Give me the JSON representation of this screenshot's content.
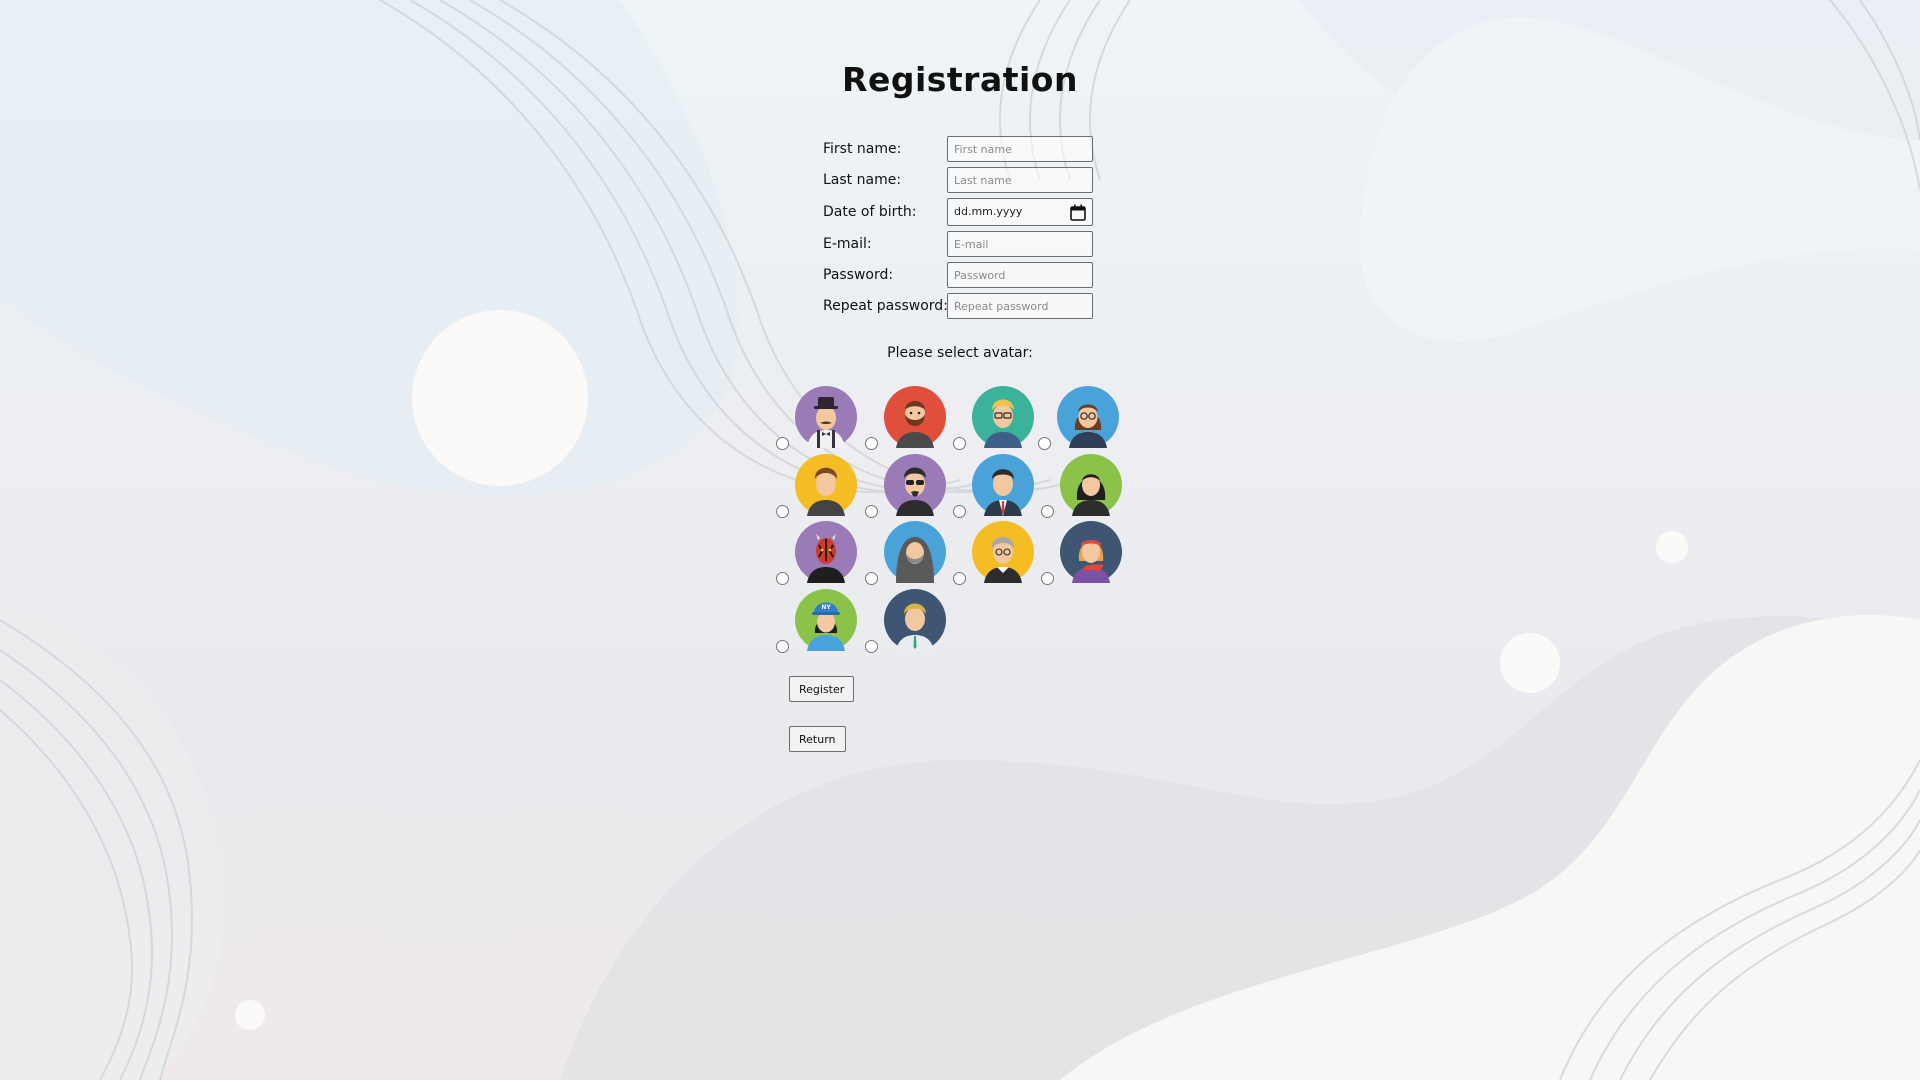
{
  "page": {
    "title": "Registration"
  },
  "form": {
    "fields": [
      {
        "label": "First name:",
        "placeholder": "First name"
      },
      {
        "label": "Last name:",
        "placeholder": "Last name"
      },
      {
        "label": "Date of birth:",
        "value": "dd.mm.yyyy"
      },
      {
        "label": "E-mail:",
        "placeholder": "E-mail"
      },
      {
        "label": "Password:",
        "placeholder": "Password"
      },
      {
        "label": "Repeat password:",
        "placeholder": "Repeat password"
      }
    ]
  },
  "avatars": {
    "heading": "Please select avatar:",
    "count": 14
  },
  "buttons": {
    "register": "Register",
    "return": "Return"
  },
  "icons": {
    "calendar": "calendar-icon"
  },
  "colors": {
    "input_border": "#6d6d6d",
    "avatar_purple": "#9b7ab8",
    "avatar_red": "#e04e3c",
    "avatar_teal": "#3bb39b",
    "avatar_blue": "#4aa3d8",
    "avatar_yellow": "#f4bd23",
    "avatar_green": "#8bc34a",
    "avatar_navy": "#3e5573"
  }
}
